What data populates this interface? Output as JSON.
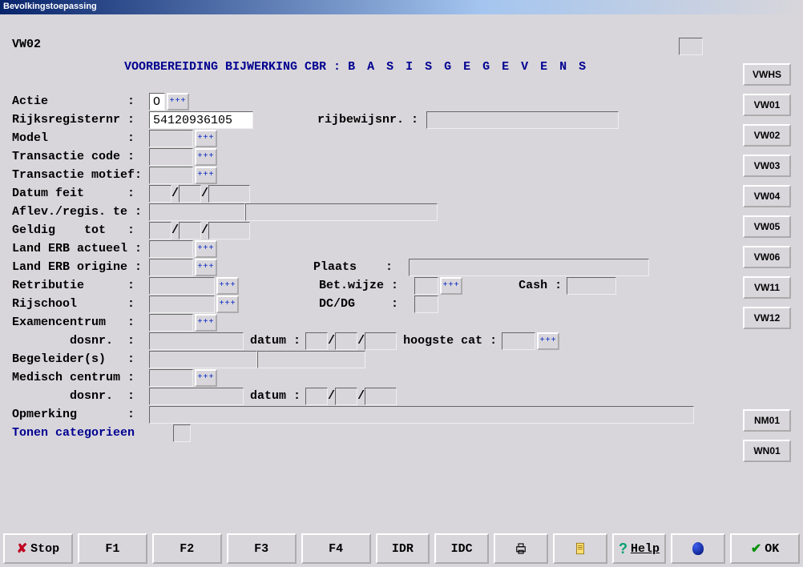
{
  "window_title": "Bevolkingstoepassing",
  "screen_code": "VW02",
  "heading_prefix": "VOORBEREIDING BIJWERKING CBR :",
  "heading_spaced": "B A S I S G E G E V E N S",
  "sidebar": [
    "VWHS",
    "VW01",
    "VW02",
    "VW03",
    "VW04",
    "VW05",
    "VW06",
    "VW11",
    "VW12"
  ],
  "sidebar2": [
    "NM01",
    "WN01"
  ],
  "labels": {
    "actie": "Actie           :",
    "rrn": "Rijksregisternr :",
    "rbn": "rijbewijsnr. :",
    "model": "Model           :",
    "tcode": "Transactie code :",
    "tmotief": "Transactie motief:",
    "datumfeit": "Datum feit      :",
    "aflev": "Aflev./regis. te :",
    "geldig": "Geldig    tot   :",
    "erbact": "Land ERB actueel :",
    "erbor": "Land ERB origine :",
    "retrib": "Retributie      :",
    "rijschool": "Rijschool       :",
    "examen": "Examencentrum   :",
    "dosnr": "        dosnr.  :",
    "begel": "Begeleider(s)   :",
    "medisch": "Medisch centrum :",
    "dosnr2": "        dosnr.  :",
    "opm": "Opmerking       :",
    "tonen": "Tonen categorieen",
    "plaats": "Plaats    :",
    "betwijze": "Bet.wijze :",
    "cash": "Cash :",
    "dcdg": "DC/DG     :",
    "datum": "datum :",
    "hoogstecat": "hoogste cat :"
  },
  "values": {
    "actie": "O",
    "rrn": "54120936105"
  },
  "footer": {
    "stop": "Stop",
    "f1": "F1",
    "f2": "F2",
    "f3": "F3",
    "f4": "F4",
    "idr": "IDR",
    "idc": "IDC",
    "help": "Help",
    "ok": "OK"
  }
}
